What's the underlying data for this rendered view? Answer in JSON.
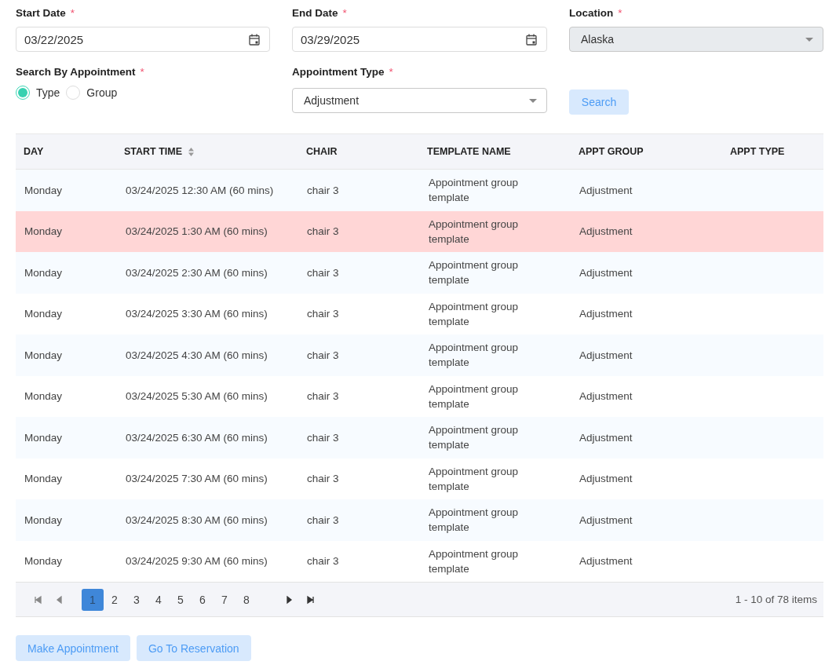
{
  "filters": {
    "start_date": {
      "label": "Start Date",
      "required": "*",
      "value": "03/22/2025"
    },
    "end_date": {
      "label": "End Date",
      "required": "*",
      "value": "03/29/2025"
    },
    "location": {
      "label": "Location",
      "required": "*",
      "value": "Alaska",
      "disabled": true
    },
    "search_by": {
      "label": "Search By Appointment",
      "required": "*",
      "options": [
        {
          "label": "Type",
          "selected": true
        },
        {
          "label": "Group",
          "selected": false
        }
      ]
    },
    "appointment_type": {
      "label": "Appointment Type",
      "required": "*",
      "value": "Adjustment"
    },
    "search_button": "Search"
  },
  "table": {
    "columns": [
      {
        "label": "DAY",
        "sortable": false
      },
      {
        "label": "START TIME",
        "sortable": true
      },
      {
        "label": "CHAIR",
        "sortable": false
      },
      {
        "label": "TEMPLATE NAME",
        "sortable": false
      },
      {
        "label": "APPT GROUP",
        "sortable": false
      },
      {
        "label": "APPT TYPE",
        "sortable": false
      }
    ],
    "rows": [
      {
        "cells": [
          "Monday",
          "03/24/2025 12:30 AM (60 mins)",
          "chair 3",
          "Appointment group template",
          "Adjustment"
        ],
        "highlighted": false
      },
      {
        "cells": [
          "Monday",
          "03/24/2025 1:30 AM (60 mins)",
          "chair 3",
          "Appointment group template",
          "Adjustment"
        ],
        "highlighted": true
      },
      {
        "cells": [
          "Monday",
          "03/24/2025 2:30 AM (60 mins)",
          "chair 3",
          "Appointment group template",
          "Adjustment"
        ],
        "highlighted": false
      },
      {
        "cells": [
          "Monday",
          "03/24/2025 3:30 AM (60 mins)",
          "chair 3",
          "Appointment group template",
          "Adjustment"
        ],
        "highlighted": false
      },
      {
        "cells": [
          "Monday",
          "03/24/2025 4:30 AM (60 mins)",
          "chair 3",
          "Appointment group template",
          "Adjustment"
        ],
        "highlighted": false
      },
      {
        "cells": [
          "Monday",
          "03/24/2025 5:30 AM (60 mins)",
          "chair 3",
          "Appointment group template",
          "Adjustment"
        ],
        "highlighted": false
      },
      {
        "cells": [
          "Monday",
          "03/24/2025 6:30 AM (60 mins)",
          "chair 3",
          "Appointment group template",
          "Adjustment"
        ],
        "highlighted": false
      },
      {
        "cells": [
          "Monday",
          "03/24/2025 7:30 AM (60 mins)",
          "chair 3",
          "Appointment group template",
          "Adjustment"
        ],
        "highlighted": false
      },
      {
        "cells": [
          "Monday",
          "03/24/2025 8:30 AM (60 mins)",
          "chair 3",
          "Appointment group template",
          "Adjustment"
        ],
        "highlighted": false
      },
      {
        "cells": [
          "Monday",
          "03/24/2025 9:30 AM (60 mins)",
          "chair 3",
          "Appointment group template",
          "Adjustment"
        ],
        "highlighted": false
      }
    ]
  },
  "pager": {
    "pages": [
      {
        "label": "1",
        "selected": true
      },
      {
        "label": "2",
        "selected": false
      },
      {
        "label": "3",
        "selected": false
      },
      {
        "label": "4",
        "selected": false
      },
      {
        "label": "5",
        "selected": false
      },
      {
        "label": "6",
        "selected": false
      },
      {
        "label": "7",
        "selected": false
      },
      {
        "label": "8",
        "selected": false
      }
    ],
    "summary": "1 - 10 of 78 items"
  },
  "buttons": [
    "Make Appointment",
    "Go To Reservation"
  ]
}
